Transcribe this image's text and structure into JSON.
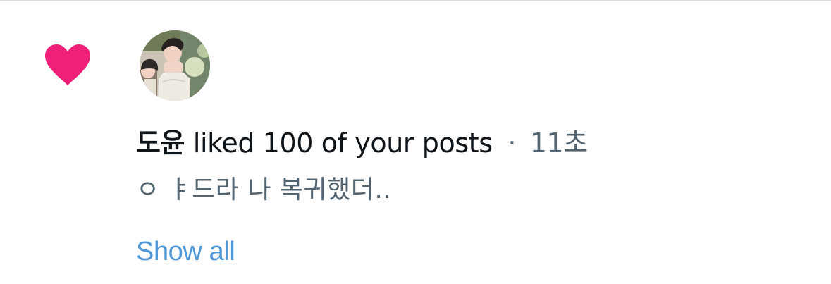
{
  "notification": {
    "actor_name": "도윤",
    "action_text": "liked 100 of your posts",
    "separator": "·",
    "time_ago": "11초",
    "post_snippet": "ㅇ ㅑ드라 나 복귀했더..",
    "show_all_label": "Show all"
  },
  "icons": {
    "type_icon": "heart-icon"
  },
  "colors": {
    "heart": "#F91880",
    "primary_text": "#0F1419",
    "secondary_text": "#536471",
    "link": "#4F97D7",
    "divider": "#D9DDE1"
  }
}
